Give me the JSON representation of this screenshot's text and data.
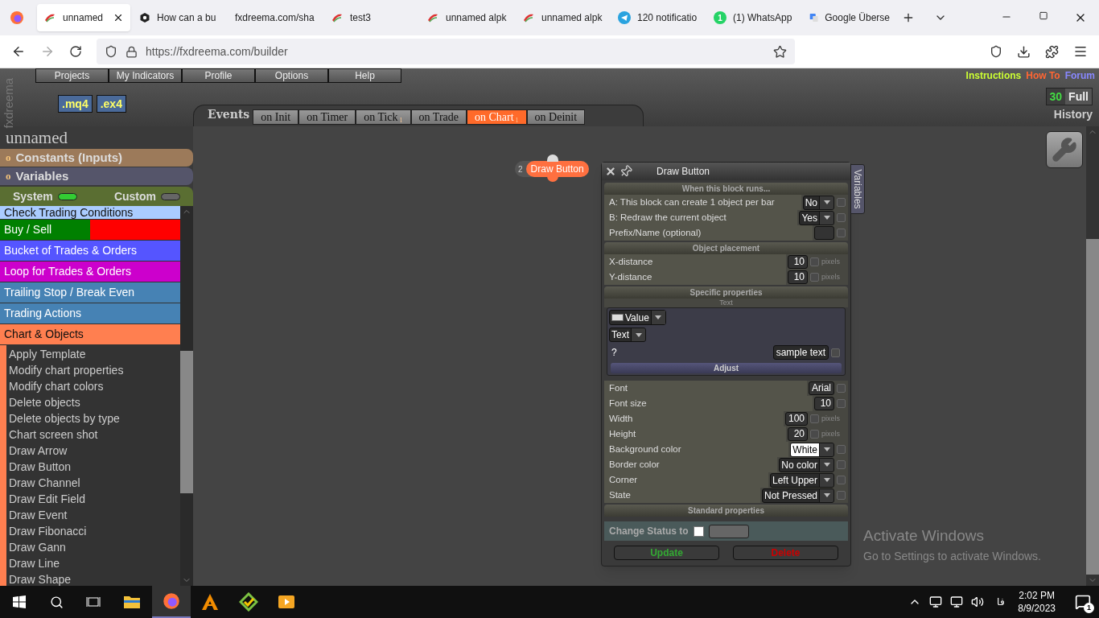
{
  "browser": {
    "tabs": [
      {
        "label": "unnamed",
        "selected": true,
        "kind": "fx"
      },
      {
        "label": "How can a bu",
        "selected": false,
        "kind": "hex"
      },
      {
        "label": "fxdreema.com/sha",
        "selected": false,
        "kind": "plain"
      },
      {
        "label": "test3",
        "selected": false,
        "kind": "fx"
      },
      {
        "label": "unnamed alpk",
        "selected": false,
        "kind": "fx"
      },
      {
        "label": "unnamed alpk",
        "selected": false,
        "kind": "fx"
      },
      {
        "label": "120 notificatio",
        "selected": false,
        "kind": "telegram"
      },
      {
        "label": "(1) WhatsApp",
        "selected": false,
        "kind": "badge",
        "badge": "1"
      },
      {
        "label": "Google Überse",
        "selected": false,
        "kind": "translate"
      }
    ],
    "url": "https://fxdreema.com/builder"
  },
  "app": {
    "brand": "fxdreema",
    "menu": [
      "Projects",
      "My Indicators",
      "Profile",
      "Options",
      "Help"
    ],
    "exports": [
      ".mq4",
      ".ex4"
    ],
    "events_label": "Events",
    "event_tabs": [
      {
        "label": "on Init",
        "selected": false
      },
      {
        "label": "on Timer",
        "selected": false
      },
      {
        "label": "on Tick",
        "selected": false,
        "badge": "1"
      },
      {
        "label": "on Trade",
        "selected": false
      },
      {
        "label": "on Chart",
        "selected": true,
        "badge": "1"
      },
      {
        "label": "on Deinit",
        "selected": false
      }
    ],
    "links": [
      {
        "label": "Instructions",
        "color": "#ccff33"
      },
      {
        "label": "How To",
        "color": "#ff6633"
      },
      {
        "label": "Forum",
        "color": "#8888ff"
      }
    ],
    "history": {
      "count": "30",
      "mode": "Full",
      "label": "History"
    }
  },
  "sidebar": {
    "project": "unnamed",
    "sections": [
      {
        "bullet": "o",
        "label": "Constants (Inputs)",
        "color": "#9c7a5a"
      },
      {
        "bullet": "o",
        "label": "Variables",
        "color": "#55556a"
      }
    ],
    "toggles": [
      {
        "label": "System",
        "on": true
      },
      {
        "label": "Custom",
        "on": false
      }
    ],
    "categories": [
      {
        "label": "Check Trading Conditions",
        "color": "#aaccff",
        "expanded": false
      },
      {
        "label": "Buy / Sell",
        "color": "#008000",
        "right_part": {
          "color": "#ff0000"
        },
        "expanded": false
      },
      {
        "label": "Bucket of Trades & Orders",
        "color": "#5555ff",
        "expanded": false
      },
      {
        "label": "Loop for Trades & Orders",
        "color": "#cc00cc",
        "expanded": false
      },
      {
        "label": "Trailing Stop / Break Even",
        "color": "#4682b4",
        "expanded": false
      },
      {
        "label": "Trading Actions",
        "color": "#4682b4",
        "expanded": false
      },
      {
        "label": "Chart & Objects",
        "color": "#ff7f50",
        "expanded": true,
        "children": [
          "Apply Template",
          "Modify chart properties",
          "Modify chart colors",
          "Delete objects",
          "Delete objects by type",
          "Chart screen shot",
          "Draw Arrow",
          "Draw Button",
          "Draw Channel",
          "Draw Edit Field",
          "Draw Event",
          "Draw Fibonacci",
          "Draw Gann",
          "Draw Line",
          "Draw Shape"
        ]
      }
    ]
  },
  "canvas": {
    "node": {
      "number": "2",
      "label": "Draw Button"
    },
    "dialog": {
      "title": "Draw Button",
      "side_tab": "Variables",
      "sections": [
        {
          "heading": "When this block runs...",
          "rows": [
            {
              "kind": "select",
              "label": "A: This block can create 1 object per bar",
              "value": "No",
              "checked": false
            },
            {
              "kind": "select",
              "label": "B: Redraw the current object",
              "value": "Yes",
              "checked": false
            },
            {
              "kind": "input",
              "label": "Prefix/Name (optional)",
              "checked": false
            }
          ]
        },
        {
          "heading": "Object placement",
          "rows": [
            {
              "kind": "input",
              "label": "X-distance",
              "value": "10",
              "unit": "pixels",
              "checked": false
            },
            {
              "kind": "input",
              "label": "Y-distance",
              "value": "10",
              "unit": "pixels",
              "checked": false
            }
          ]
        },
        {
          "heading": "Specific properties",
          "subheading": "Text",
          "text_box": {
            "source": "Value",
            "type": "Text",
            "hint": "?",
            "value": "sample text",
            "checked": false,
            "adjust": "Adjust"
          },
          "rows": [
            {
              "kind": "input",
              "label": "Font",
              "value": "Arial",
              "checked": false
            },
            {
              "kind": "input",
              "label": "Font size",
              "value": "10",
              "checked": false
            },
            {
              "kind": "input",
              "label": "Width",
              "value": "100",
              "unit": "pixels",
              "checked": false
            },
            {
              "kind": "input",
              "label": "Height",
              "value": "20",
              "unit": "pixels",
              "checked": false
            },
            {
              "kind": "select",
              "label": "Background color",
              "value": "White",
              "color": "#ffffff",
              "checked": false
            },
            {
              "kind": "select",
              "label": "Border color",
              "value": "No color",
              "checked": false
            },
            {
              "kind": "select",
              "label": "Corner",
              "value": "Left Upper",
              "checked": false
            },
            {
              "kind": "select",
              "label": "State",
              "value": "Not Pressed",
              "checked": false
            }
          ]
        },
        {
          "heading": "Standard properties"
        }
      ],
      "status": {
        "label": "Change Status to",
        "checked": false
      },
      "buttons": [
        {
          "label": "Update",
          "kind": "update"
        },
        {
          "label": "Delete",
          "kind": "delete"
        }
      ]
    },
    "watermark": {
      "title": "Activate Windows",
      "text": "Go to Settings to activate Windows."
    }
  },
  "taskbar": {
    "language": "فا",
    "time": "2:02 PM",
    "date": "8/9/2023",
    "notifications": "1"
  }
}
